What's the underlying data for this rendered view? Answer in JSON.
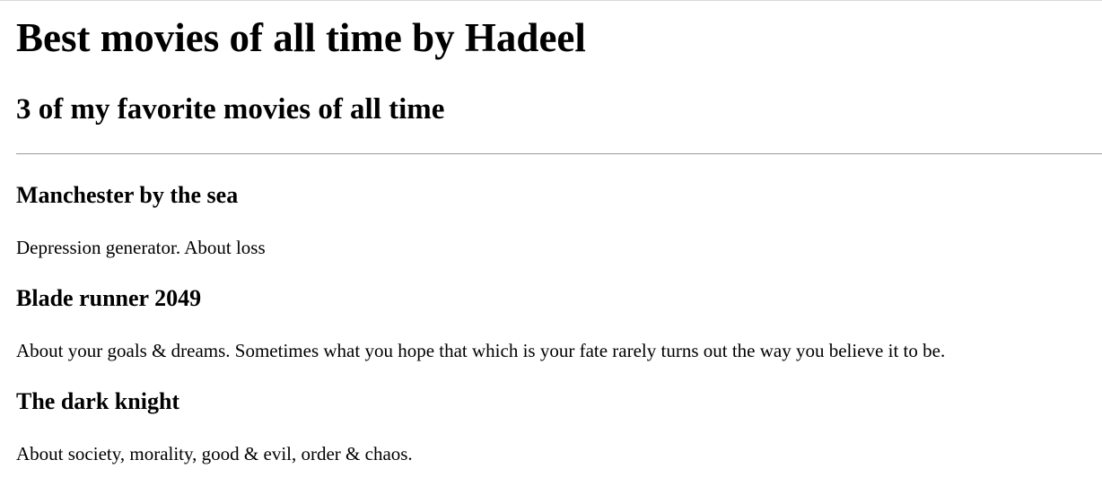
{
  "page": {
    "title": "Best movies of all time by Hadeel",
    "subtitle": "3 of my favorite movies of all time"
  },
  "movies": [
    {
      "title": "Manchester by the sea",
      "description": "Depression generator. About loss"
    },
    {
      "title": "Blade runner 2049",
      "description": "About your goals & dreams. Sometimes what you hope that which is your fate rarely turns out the way you believe it to be."
    },
    {
      "title": "The dark knight",
      "description": "About society, morality, good & evil, order & chaos."
    }
  ]
}
